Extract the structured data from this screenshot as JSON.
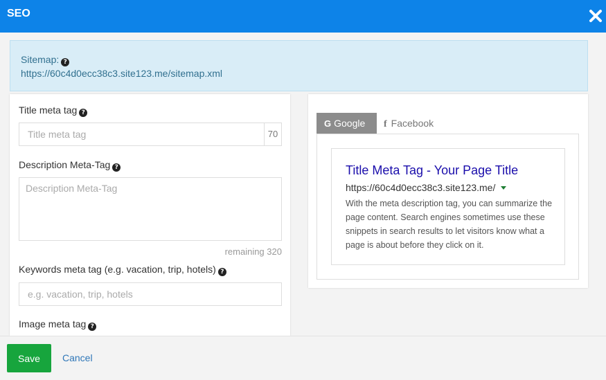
{
  "header": {
    "title": "SEO",
    "close_icon": "close-icon"
  },
  "sitemap": {
    "label": "Sitemap:",
    "url": "https://60c4d0ecc38c3.site123.me/sitemap.xml"
  },
  "form": {
    "title_label": "Title meta tag",
    "title_placeholder": "Title meta tag",
    "title_value": "",
    "title_counter": "70",
    "description_label": "Description Meta-Tag",
    "description_placeholder": "Description Meta-Tag",
    "description_value": "",
    "remaining_text": "remaining",
    "remaining_count": "320",
    "keywords_label": "Keywords meta tag (e.g. vacation, trip, hotels)",
    "keywords_placeholder": "e.g. vacation, trip, hotels",
    "keywords_value": "",
    "image_label": "Image meta tag"
  },
  "preview": {
    "tabs": [
      {
        "label": "Google",
        "icon": "google-icon",
        "active": true
      },
      {
        "label": "Facebook",
        "icon": "facebook-icon",
        "active": false
      }
    ],
    "title": "Title Meta Tag - Your Page Title",
    "url": "https://60c4d0ecc38c3.site123.me/",
    "description": "With the meta description tag, you can summarize the page content. Search engines sometimes use these snippets in search results to let visitors know what a page is about before they click on it."
  },
  "footer": {
    "save_label": "Save",
    "cancel_label": "Cancel"
  },
  "colors": {
    "header": "#0d83e8",
    "save": "#17a53d",
    "link": "#2f77b8",
    "preview_title": "#1a0dab"
  }
}
